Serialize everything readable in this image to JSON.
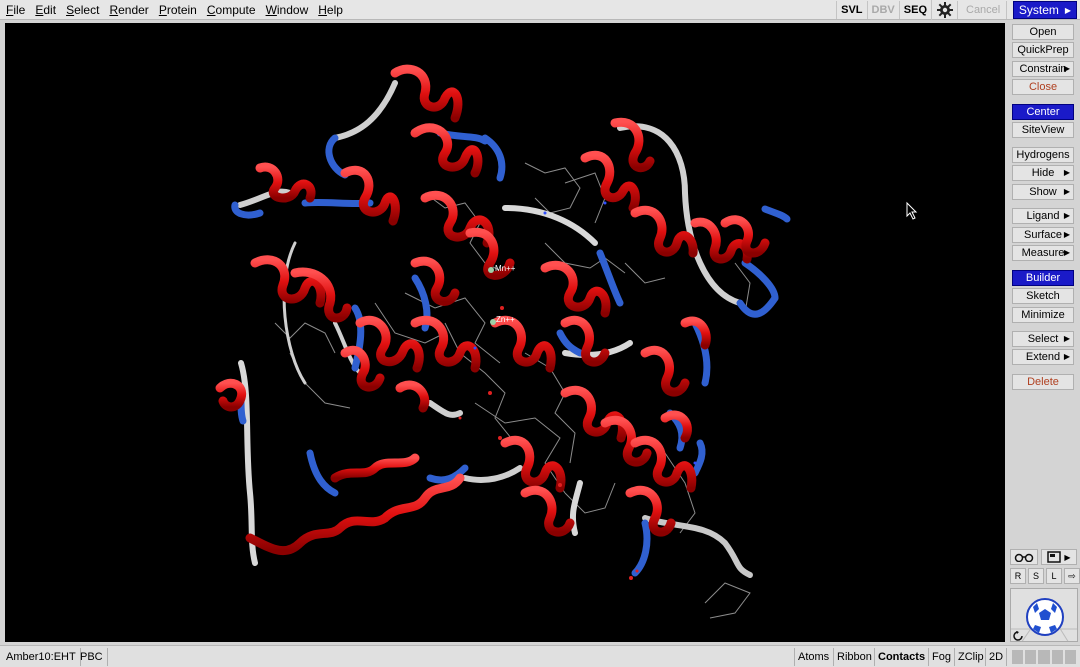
{
  "menubar": {
    "items": [
      "File",
      "Edit",
      "Select",
      "Render",
      "Protein",
      "Compute",
      "Window",
      "Help"
    ],
    "toggles": [
      "SVL",
      "DBV",
      "SEQ"
    ],
    "cancel_label": "Cancel",
    "system_label": "System",
    "gear_icon": "gear-icon"
  },
  "viewport": {
    "labels": {
      "mn": "Mn++",
      "zn": "Zn++"
    },
    "cursor_icon": "arrow-cursor-icon",
    "colors": {
      "background": "#000000",
      "helix": "#e81818",
      "strand_turn": "#2f5fd0",
      "coil": "#c8c8c8",
      "ligand": "#8a8a8a"
    }
  },
  "rightpanel": {
    "buttons": {
      "open": "Open",
      "quickprep": "QuickPrep",
      "constrain": "Constrain",
      "close": "Close",
      "center": "Center",
      "siteview": "SiteView",
      "hydrogens": "Hydrogens",
      "hide": "Hide",
      "show": "Show",
      "ligand": "Ligand",
      "surface": "Surface",
      "measure": "Measure",
      "builder": "Builder",
      "sketch": "Sketch",
      "minimize": "Minimize",
      "select": "Select",
      "extend": "Extend",
      "delete": "Delete"
    },
    "small": [
      "R",
      "S",
      "L"
    ],
    "icons": [
      "stereo-glasses-icon",
      "display-icon",
      "rotate-icon",
      "soccer-ball-icon"
    ]
  },
  "statusbar": {
    "forcefield": "Amber10:EHT",
    "pbc": "PBC",
    "right": [
      "Atoms",
      "Ribbon",
      "Contacts",
      "Fog",
      "ZClip",
      "2D"
    ]
  }
}
